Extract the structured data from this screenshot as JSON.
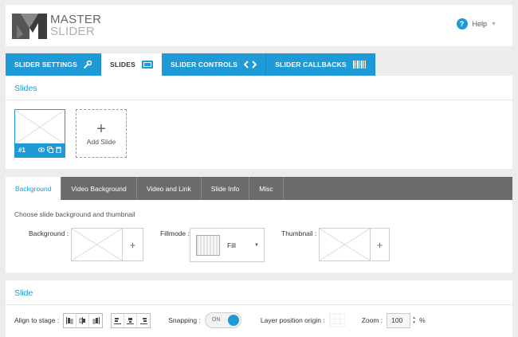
{
  "header": {
    "logo_line1": "MASTER",
    "logo_line2": "SLIDER",
    "help_icon": "?",
    "help_label": "Help"
  },
  "main_tabs": [
    {
      "label": "SLIDER SETTINGS",
      "icon": "wrench-icon"
    },
    {
      "label": "SLIDES",
      "icon": "slides-icon"
    },
    {
      "label": "SLIDER CONTROLS",
      "icon": "arrows-icon"
    },
    {
      "label": "SLIDER CALLBACKS",
      "icon": "barcode-icon"
    }
  ],
  "slides_section": {
    "title": "Slides",
    "slides": [
      {
        "number": "#1"
      }
    ],
    "add_slide": "Add Slide"
  },
  "background_section": {
    "tabs": [
      "Background",
      "Video Background",
      "Video and Link",
      "Slide Info",
      "Misc"
    ],
    "description": "Choose slide background and thumbnail",
    "background_label": "Background :",
    "fillmode_label": "Fillmode :",
    "fillmode_value": "Fill",
    "thumbnail_label": "Thumbnail :",
    "plus": "+"
  },
  "slide_section": {
    "title": "Slide",
    "align_label": "Align to stage :",
    "snapping_label": "Snapping :",
    "snapping_value": "ON",
    "origin_label": "Layer position origin :",
    "zoom_label": "Zoom :",
    "zoom_value": "100",
    "zoom_unit": "%"
  },
  "colors": {
    "accent": "#1e9ad6",
    "subtab_bar": "#6b6b6b"
  }
}
